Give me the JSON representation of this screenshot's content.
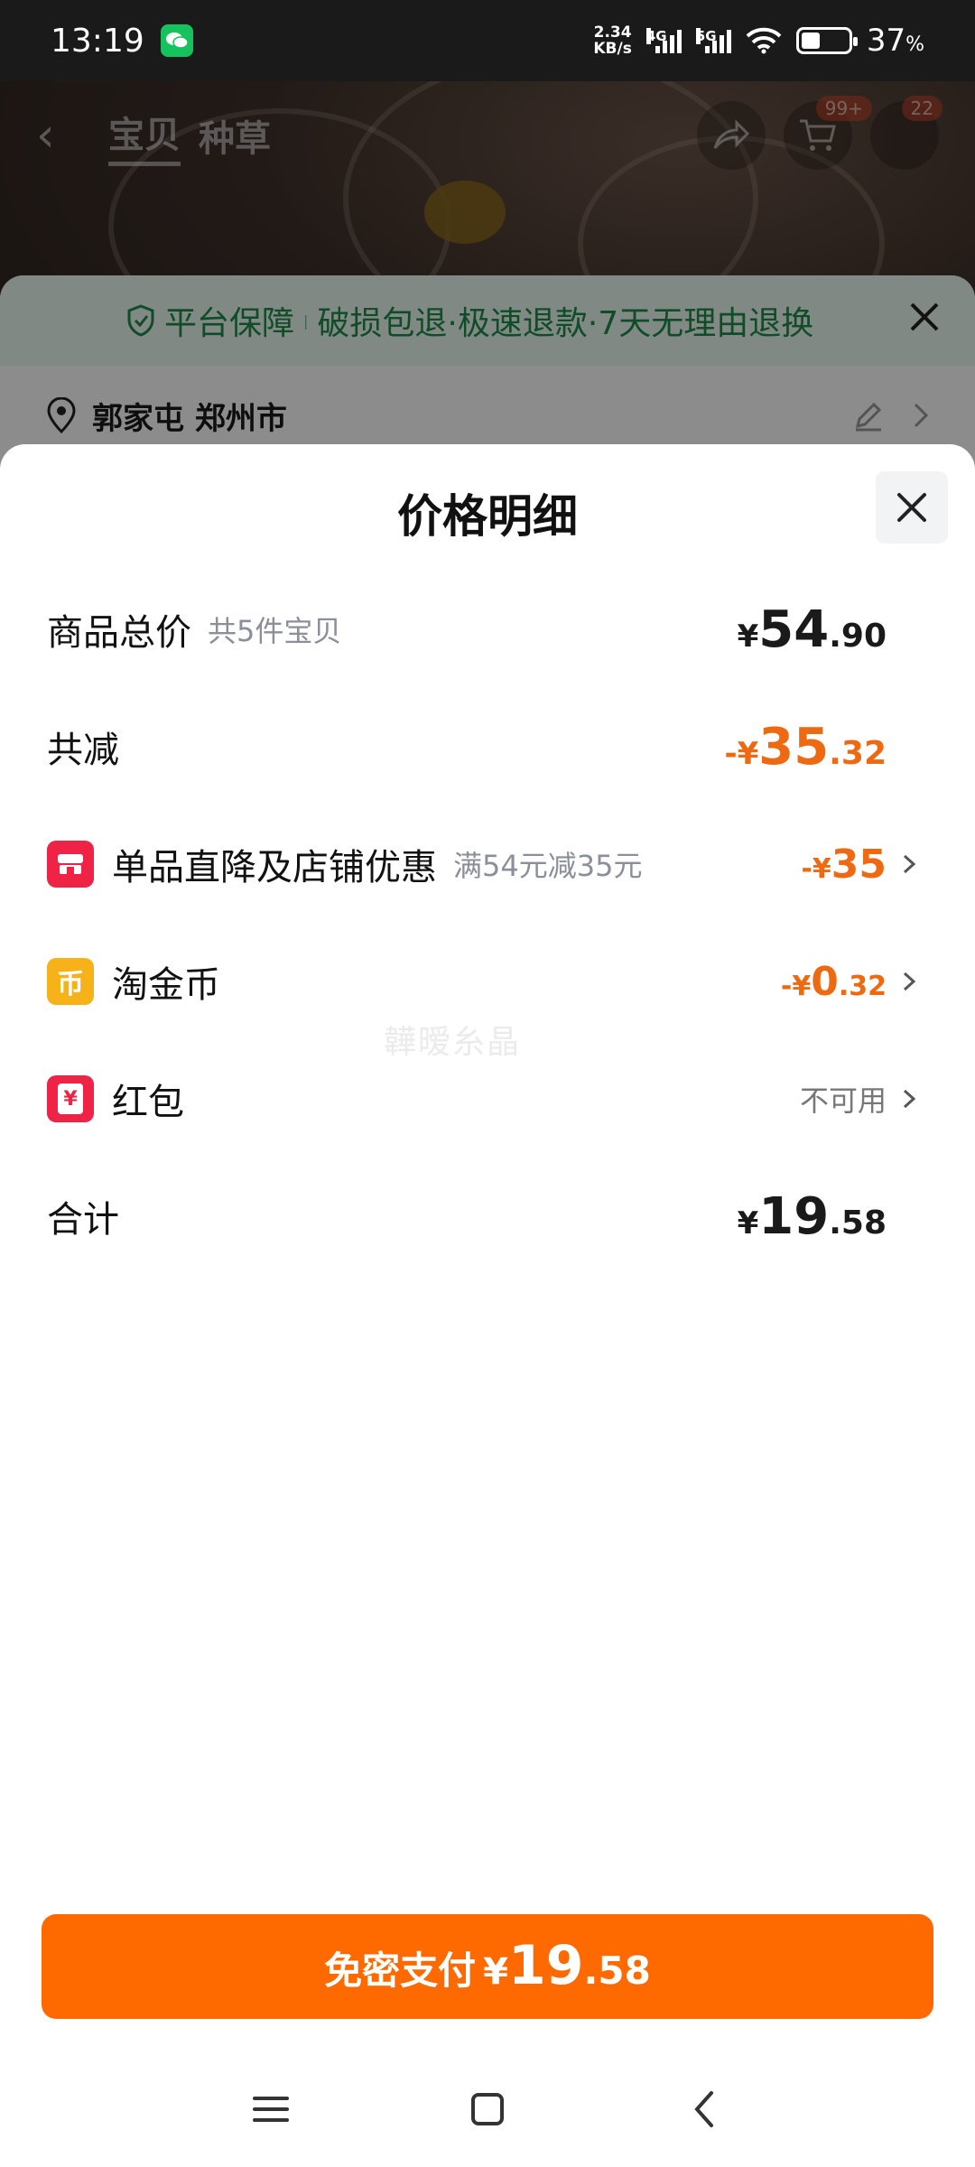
{
  "status_bar": {
    "time": "13:19",
    "net_speed_value": "2.34",
    "net_speed_unit": "KB/s",
    "sim1_label": "4G",
    "sim2_label": "5G",
    "battery_pct": "37",
    "battery_unit": "%"
  },
  "product_nav": {
    "tabs": [
      "宝贝",
      "种草"
    ],
    "cart_badge": "99+",
    "message_badge": "22"
  },
  "guarantee": {
    "label": "平台保障",
    "separator": "|",
    "text": "破损包退·极速退款·7天无理由退换"
  },
  "address": {
    "text": "郭家屯 郑州市"
  },
  "price_sheet": {
    "title": "价格明细",
    "rows": {
      "subtotal": {
        "label": "商品总价",
        "sub": "共5件宝贝",
        "yen": "¥",
        "int": "54",
        "dec": ".90"
      },
      "discount_total": {
        "label": "共减",
        "yen": "-¥",
        "int": "35",
        "dec": ".32"
      },
      "store_discount": {
        "label": "单品直降及店铺优惠",
        "sub": "满54元减35元",
        "yen": "-¥",
        "int": "35"
      },
      "coins": {
        "label": "淘金币",
        "icon_text": "币",
        "yen": "-¥",
        "int": "0",
        "dec": ".32"
      },
      "red_packet": {
        "label": "红包",
        "icon_text": "¥",
        "status": "不可用"
      },
      "total": {
        "label": "合计",
        "yen": "¥",
        "int": "19",
        "dec": ".58"
      }
    },
    "watermark": "韡暧糸晶"
  },
  "pay_button": {
    "label": "免密支付",
    "yen": "¥",
    "int": "19",
    "dec": ".58"
  },
  "colors": {
    "accent_orange": "#ff6a00",
    "discount_orange": "#ee6a12",
    "guarantee_green": "#1f8a4c",
    "shop_red": "#ee2346",
    "coin_yellow": "#f7b21a"
  },
  "icons": {
    "close": "close-icon",
    "chevron": "chevron-right-icon",
    "shield": "shield-check-icon",
    "location": "location-pin-icon",
    "edit": "edit-pencil-icon",
    "share": "share-icon",
    "cart": "cart-icon",
    "wechat": "wechat-icon"
  }
}
